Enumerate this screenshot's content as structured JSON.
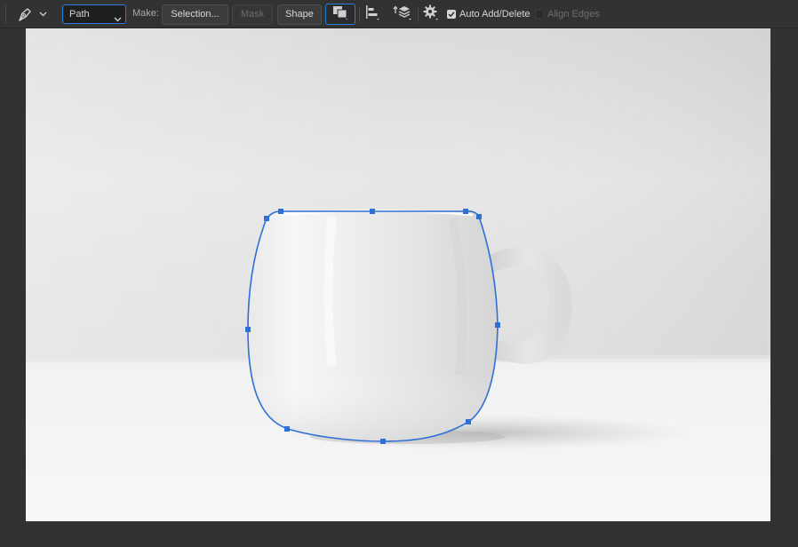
{
  "options_bar": {
    "tool_icon": "pen-tool-icon",
    "tool_preset_icon": "chevron-down-icon",
    "mode_select": {
      "value": "Path",
      "icon": "chevron-down-icon"
    },
    "make_label": "Make:",
    "selection_button": "Selection...",
    "mask_button": "Mask",
    "shape_button": "Shape",
    "path_operations_icon": "path-operations-icon",
    "path_alignment_icon": "path-alignment-icon",
    "path_arrangement_icon": "path-arrangement-icon",
    "settings_icon": "gear-icon",
    "auto_add_delete": {
      "label": "Auto Add/Delete",
      "checked": true
    },
    "align_edges": {
      "label": "Align Edges",
      "checked": false,
      "enabled": false
    }
  },
  "canvas": {
    "subject": "white-mug-photo",
    "path_color": "#2f6fd6",
    "anchor_count": 10
  }
}
